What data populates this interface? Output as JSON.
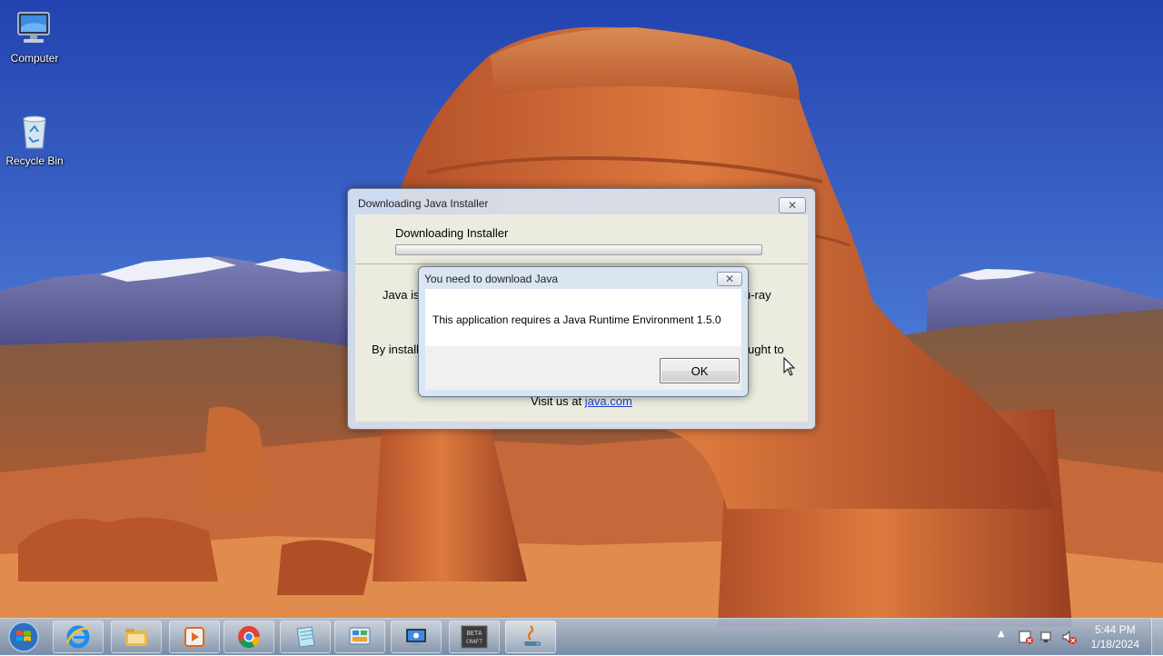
{
  "desktop": {
    "icons": [
      {
        "label": "Computer",
        "icon": "computer-icon"
      },
      {
        "label": "Recycle Bin",
        "icon": "recycle-bin-icon"
      }
    ]
  },
  "installer_window": {
    "title": "Downloading Java Installer",
    "heading": "Downloading Installer",
    "progress": 0,
    "text_left_1": "Java is",
    "text_right_1": "u-ray",
    "text_left_2": "By install",
    "text_right_2": "ught to",
    "visit_prefix": "Visit us at",
    "visit_link": "java.com"
  },
  "alert_dialog": {
    "title": "You need to download Java",
    "message": "This application requires a Java Runtime Environment 1.5.0",
    "ok_label": "OK"
  },
  "taskbar": {
    "start_icon": "windows-start-icon",
    "pinned": [
      {
        "name": "internet-explorer-icon"
      },
      {
        "name": "file-explorer-icon"
      },
      {
        "name": "media-player-icon"
      },
      {
        "name": "chrome-icon"
      },
      {
        "name": "notepad-icon"
      },
      {
        "name": "control-panel-icon"
      },
      {
        "name": "system-info-icon"
      },
      {
        "name": "beta-craft-icon",
        "label": "BETA CRAFT"
      },
      {
        "name": "java-icon"
      }
    ],
    "tray": {
      "time": "5:44 PM",
      "date": "1/18/2024"
    }
  },
  "colors": {
    "link": "#1a3fd1",
    "taskbar": "#8aa6c4",
    "sky_top": "#2c4fb8",
    "rock": "#c8612e"
  }
}
